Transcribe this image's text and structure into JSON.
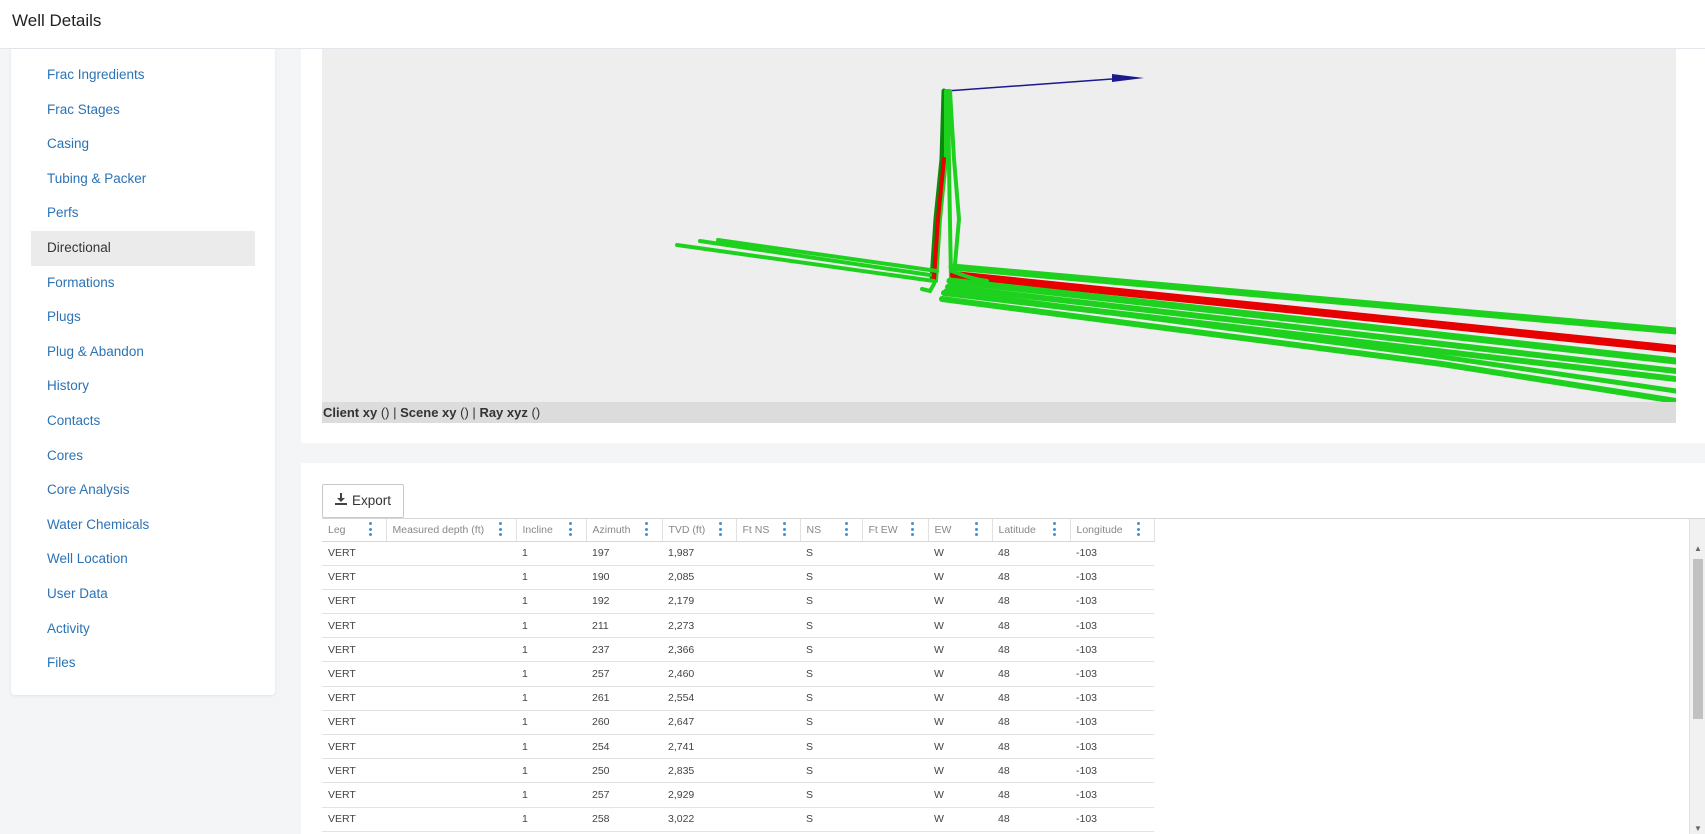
{
  "header": {
    "title": "Well Details"
  },
  "sidebar": {
    "items": [
      {
        "label": "Frac Ingredients",
        "active": false
      },
      {
        "label": "Frac Stages",
        "active": false
      },
      {
        "label": "Casing",
        "active": false
      },
      {
        "label": "Tubing & Packer",
        "active": false
      },
      {
        "label": "Perfs",
        "active": false
      },
      {
        "label": "Directional",
        "active": true
      },
      {
        "label": "Formations",
        "active": false
      },
      {
        "label": "Plugs",
        "active": false
      },
      {
        "label": "Plug & Abandon",
        "active": false
      },
      {
        "label": "History",
        "active": false
      },
      {
        "label": "Contacts",
        "active": false
      },
      {
        "label": "Cores",
        "active": false
      },
      {
        "label": "Core Analysis",
        "active": false
      },
      {
        "label": "Water Chemicals",
        "active": false
      },
      {
        "label": "Well Location",
        "active": false
      },
      {
        "label": "User Data",
        "active": false
      },
      {
        "label": "Activity",
        "active": false
      },
      {
        "label": "Files",
        "active": false
      }
    ]
  },
  "viewer": {
    "status": {
      "client_label": "Client xy",
      "client_value": "()",
      "scene_label": "Scene xy",
      "scene_value": "()",
      "ray_label": "Ray xyz",
      "ray_value": "()",
      "separator": "|"
    },
    "colors": {
      "wells": "#1fd11f",
      "highlight": "#e60000",
      "arrow": "#1a1a8c",
      "background": "#eeeeee"
    }
  },
  "table": {
    "export_label": "Export",
    "columns": [
      "Leg",
      "Measured depth (ft)",
      "Incline",
      "Azimuth",
      "TVD (ft)",
      "Ft NS",
      "NS",
      "Ft EW",
      "EW",
      "Latitude",
      "Longitude"
    ],
    "rows": [
      [
        "VERT",
        "",
        "1",
        "197",
        "1,987",
        "",
        "S",
        "",
        "W",
        "48",
        "-103"
      ],
      [
        "VERT",
        "",
        "1",
        "190",
        "2,085",
        "",
        "S",
        "",
        "W",
        "48",
        "-103"
      ],
      [
        "VERT",
        "",
        "1",
        "192",
        "2,179",
        "",
        "S",
        "",
        "W",
        "48",
        "-103"
      ],
      [
        "VERT",
        "",
        "1",
        "211",
        "2,273",
        "",
        "S",
        "",
        "W",
        "48",
        "-103"
      ],
      [
        "VERT",
        "",
        "1",
        "237",
        "2,366",
        "",
        "S",
        "",
        "W",
        "48",
        "-103"
      ],
      [
        "VERT",
        "",
        "1",
        "257",
        "2,460",
        "",
        "S",
        "",
        "W",
        "48",
        "-103"
      ],
      [
        "VERT",
        "",
        "1",
        "261",
        "2,554",
        "",
        "S",
        "",
        "W",
        "48",
        "-103"
      ],
      [
        "VERT",
        "",
        "1",
        "260",
        "2,647",
        "",
        "S",
        "",
        "W",
        "48",
        "-103"
      ],
      [
        "VERT",
        "",
        "1",
        "254",
        "2,741",
        "",
        "S",
        "",
        "W",
        "48",
        "-103"
      ],
      [
        "VERT",
        "",
        "1",
        "250",
        "2,835",
        "",
        "S",
        "",
        "W",
        "48",
        "-103"
      ],
      [
        "VERT",
        "",
        "1",
        "257",
        "2,929",
        "",
        "S",
        "",
        "W",
        "48",
        "-103"
      ],
      [
        "VERT",
        "",
        "1",
        "258",
        "3,022",
        "",
        "S",
        "",
        "W",
        "48",
        "-103"
      ]
    ]
  }
}
